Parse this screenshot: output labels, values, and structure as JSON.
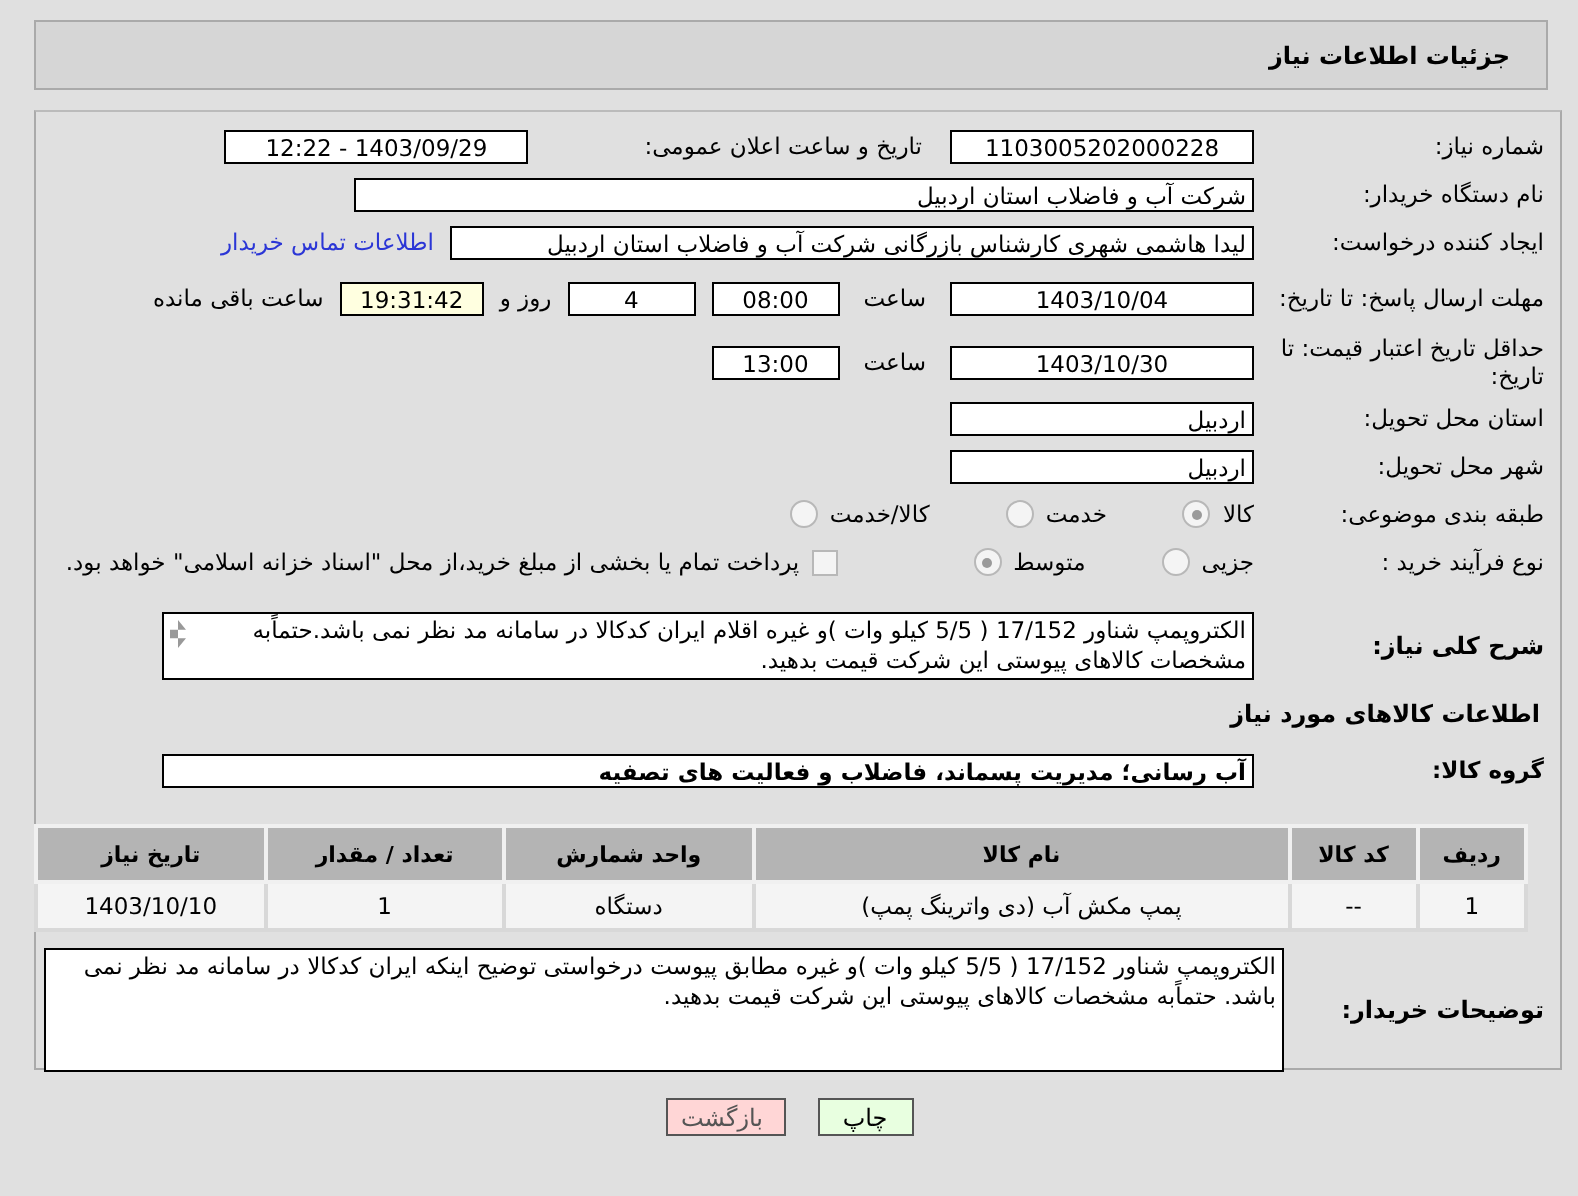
{
  "header_title": "جزئیات اطلاعات نیاز",
  "need_number": {
    "label": "شماره نیاز:",
    "value": "1103005202000228"
  },
  "announce": {
    "label": "تاریخ و ساعت اعلان عمومی:",
    "value": "1403/09/29 - 12:22"
  },
  "buyer_org": {
    "label": "نام دستگاه خریدار:",
    "value": "شرکت آب و فاضلاب استان اردبیل"
  },
  "requester": {
    "label": "ایجاد کننده درخواست:",
    "value": "لیدا  هاشمی شهری کارشناس بازرگانی شرکت آب و فاضلاب استان اردبیل",
    "link": "اطلاعات تماس خریدار"
  },
  "reply_deadline": {
    "label": "مهلت ارسال پاسخ: تا تاریخ:",
    "date": "1403/10/04",
    "time_label": "ساعت",
    "time": "08:00",
    "days": "4",
    "days_label": "روز و",
    "remaining": "19:31:42",
    "remaining_label": "ساعت باقی مانده"
  },
  "price_validity": {
    "label": "حداقل تاریخ اعتبار قیمت: تا تاریخ:",
    "date": "1403/10/30",
    "time_label": "ساعت",
    "time": "13:00"
  },
  "province": {
    "label": "استان محل تحویل:",
    "value": "اردبیل"
  },
  "city": {
    "label": "شهر محل تحویل:",
    "value": "اردبیل"
  },
  "category": {
    "label": "طبقه بندی موضوعی:",
    "options": [
      {
        "label": "کالا",
        "selected": true
      },
      {
        "label": "خدمت",
        "selected": false
      },
      {
        "label": "کالا/خدمت",
        "selected": false
      }
    ]
  },
  "process": {
    "label": "نوع فرآیند خرید :",
    "options": [
      {
        "label": "جزیی",
        "selected": false
      },
      {
        "label": "متوسط",
        "selected": true
      }
    ],
    "payment": {
      "checked": false,
      "label": "پرداخت تمام یا بخشی از مبلغ خرید،از محل \"اسناد خزانه اسلامی\" خواهد بود."
    }
  },
  "description": {
    "label": "شرح کلی نیاز:",
    "value": "الکتروپمپ شناور 17/152    ( 5/5 کیلو وات )و غیره اقلام ایران کدکالا در سامانه مد نظر نمی باشد.حتماًبه مشخصات کالاهای پیوستی این شرکت قیمت بدهید."
  },
  "goods_title": "اطلاعات کالاهای مورد نیاز",
  "goods_group": {
    "label": "گروه کالا:",
    "value": "آب رسانی؛ مدیریت پسماند، فاضلاب و فعالیت های تصفیه"
  },
  "table": {
    "columns": [
      "ردیف",
      "کد کالا",
      "نام کالا",
      "واحد شمارش",
      "تعداد / مقدار",
      "تاریخ نیاز"
    ],
    "rows": [
      [
        "1",
        "--",
        "پمپ مکش آب (دی واترینگ پمپ)",
        "دستگاه",
        "1",
        "1403/10/10"
      ]
    ]
  },
  "buyer_notes": {
    "label": "توضیحات خریدار:",
    "value": "الکتروپمپ شناور 17/152    ( 5/5 کیلو وات )و غیره  مطابق پیوست درخواستی   توضیح اینکه ایران کدکالا در سامانه مد نظر نمی باشد. حتماًبه  مشخصات کالاهای پیوستی این شرکت قیمت بدهید."
  },
  "buttons": [
    {
      "label": "چاپ",
      "kind": "print"
    },
    {
      "label": "بازگشت",
      "kind": "back"
    }
  ]
}
